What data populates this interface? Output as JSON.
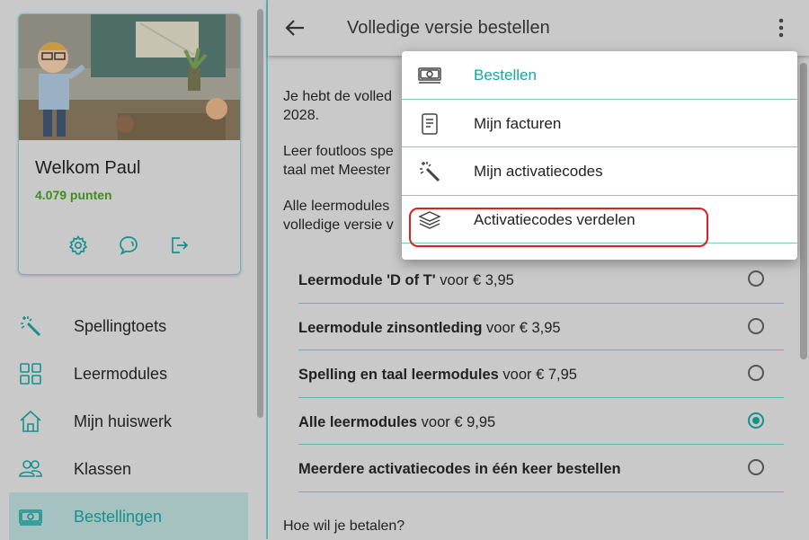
{
  "sidebar": {
    "welcome": "Welkom Paul",
    "points": "4.079 punten",
    "card_icons": [
      "gear-icon",
      "chat-icon",
      "logout-icon"
    ],
    "items": [
      {
        "label": "Spellingtoets",
        "icon": "magic-wand-icon"
      },
      {
        "label": "Leermodules",
        "icon": "grid-icon"
      },
      {
        "label": "Mijn huiswerk",
        "icon": "home-icon"
      },
      {
        "label": "Klassen",
        "icon": "users-icon"
      },
      {
        "label": "Bestellingen",
        "icon": "money-icon",
        "active": true
      }
    ]
  },
  "header": {
    "title": "Volledige versie bestellen"
  },
  "main": {
    "para1_line1": "Je hebt de volled",
    "para1_line2": "2028.",
    "para2_line1": "Leer foutloos spe",
    "para2_line2": "taal met Meester",
    "para3_line1": "Alle leermodules",
    "para3_line2": "volledige versie v",
    "options": [
      {
        "bold": "Leermodule 'D of T'",
        "rest": " voor € 3,95",
        "selected": false
      },
      {
        "bold": "Leermodule zinsontleding",
        "rest": " voor € 3,95",
        "selected": false
      },
      {
        "bold": "Spelling en taal leermodules",
        "rest": " voor € 7,95",
        "selected": false
      },
      {
        "bold": "Alle leermodules",
        "rest": " voor € 9,95",
        "selected": true
      },
      {
        "bold": "Meerdere activatiecodes in één keer bestellen",
        "rest": "",
        "selected": false
      }
    ],
    "pay_question": "Hoe wil je betalen?"
  },
  "menu": {
    "items": [
      {
        "label": "Bestellen",
        "icon": "money-icon"
      },
      {
        "label": "Mijn facturen",
        "icon": "document-icon"
      },
      {
        "label": "Mijn activatiecodes",
        "icon": "magic-wand-icon"
      },
      {
        "label": "Activatiecodes verdelen",
        "icon": "layers-icon"
      }
    ]
  },
  "colors": {
    "accent": "#16a6a1",
    "points": "#3f8e1b",
    "highlight": "#e02020"
  }
}
